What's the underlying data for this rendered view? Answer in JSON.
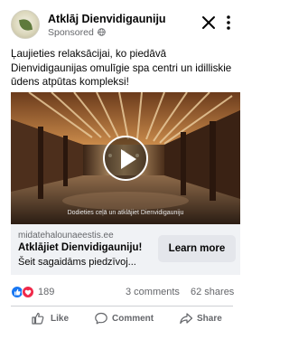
{
  "header": {
    "page_name": "Atklāj Dienvidigauniju",
    "sponsored_label": "Sponsored ·"
  },
  "post": {
    "text": "Ļaujieties relaksācijai, ko piedāvā Dienvidigaunijas omulīgie spa centri un idilliskie ūdens atpūtas kompleksi!"
  },
  "video": {
    "caption": "Dodieties ceļā un atklājiet Dienvidigauniju"
  },
  "link_preview": {
    "domain": "midatehalounaeestis.ee",
    "headline": "Atklājiet Dienvidigauniju!",
    "description": "Šeit sagaidāms piedzīvoj...",
    "cta_label": "Learn more"
  },
  "engagement": {
    "reaction_count": "189",
    "comments": "3 comments",
    "shares": "62 shares"
  },
  "actions": {
    "like": "Like",
    "comment": "Comment",
    "share": "Share"
  },
  "colors": {
    "brand_blue": "#1877f2",
    "love_red": "#f02849",
    "secondary_text": "#65676b",
    "preview_bg": "#f0f2f5",
    "button_bg": "#e4e6eb"
  },
  "icons": {
    "close": "close-icon",
    "more": "more-options-icon",
    "play": "play-icon",
    "like": "thumbs-up-icon",
    "comment": "comment-bubble-icon",
    "share": "share-arrow-icon"
  }
}
